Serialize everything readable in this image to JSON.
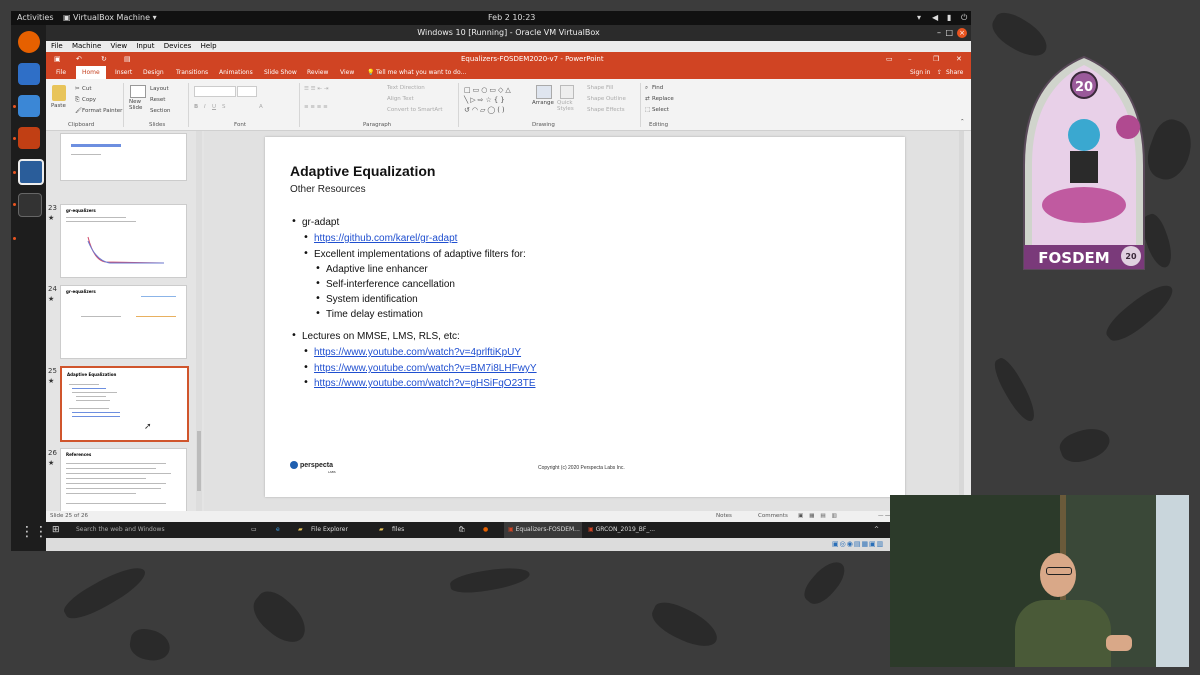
{
  "ubuntu": {
    "activities": "Activities",
    "app_menu": "VirtualBox Machine ▾",
    "clock": "Feb 2  10:23"
  },
  "vbox": {
    "title": "Windows 10 [Running] - Oracle VM VirtualBox",
    "menu": [
      "File",
      "Machine",
      "View",
      "Input",
      "Devices",
      "Help"
    ]
  },
  "ppt": {
    "title": "Equalizers-FOSDEM2020-v7 - PowerPoint",
    "tabs": [
      "File",
      "Home",
      "Insert",
      "Design",
      "Transitions",
      "Animations",
      "Slide Show",
      "Review",
      "View"
    ],
    "tell_me": "Tell me what you want to do...",
    "sign_in": "Sign in",
    "share": "Share",
    "ribbon": {
      "paste": "Paste",
      "cut": "Cut",
      "copy": "Copy",
      "format_painter": "Format Painter",
      "clipboard": "Clipboard",
      "new_slide": "New Slide",
      "layout": "Layout",
      "reset": "Reset",
      "section": "Section",
      "slides": "Slides",
      "font": "Font",
      "text_direction": "Text Direction",
      "align_text": "Align Text",
      "convert_smartart": "Convert to SmartArt",
      "paragraph": "Paragraph",
      "arrange": "Arrange",
      "quick_styles": "Quick Styles",
      "shape_fill": "Shape Fill",
      "shape_outline": "Shape Outline",
      "shape_effects": "Shape Effects",
      "drawing": "Drawing",
      "find": "Find",
      "replace": "Replace",
      "select": "Select",
      "editing": "Editing"
    },
    "thumb_numbers": [
      "23",
      "24",
      "25",
      "26"
    ],
    "thumb_titles": [
      "gr-equalizers",
      "gr-equalizers",
      "Adaptive Equalization",
      "References"
    ],
    "slide": {
      "title": "Adaptive Equalization",
      "subtitle": "Other Resources",
      "b1": "gr-adapt",
      "b1_link": "https://github.com/karel/gr-adapt",
      "b1_sub": "Excellent implementations of adaptive filters for:",
      "b1_items": [
        "Adaptive line enhancer",
        "Self-interference cancellation",
        "System identification",
        "Time delay estimation"
      ],
      "b2": "Lectures on MMSE, LMS, RLS, etc:",
      "b2_links": [
        "https://www.youtube.com/watch?v=4prlftiKpUY",
        "https://www.youtube.com/watch?v=BM7i8LHFwyY",
        "https://www.youtube.com/watch?v=gHSiFqO23TE"
      ],
      "logo": "perspecta",
      "logo_sub": "LABS",
      "copyright": "Copyright (c) 2020 Perspecta Labs Inc."
    },
    "status": {
      "slide_count": "Slide 25 of 26",
      "notes": "Notes",
      "comments": "Comments"
    }
  },
  "taskbar": {
    "search": "Search the web and Windows",
    "file_explorer": "File Explorer",
    "files": "files",
    "ppt_task": "Equalizers-FOSDEM...",
    "ppt_task2": "GRCON_2019_BF_..."
  },
  "badge": {
    "number": "20",
    "label": "FOSDEM",
    "year": "20"
  }
}
